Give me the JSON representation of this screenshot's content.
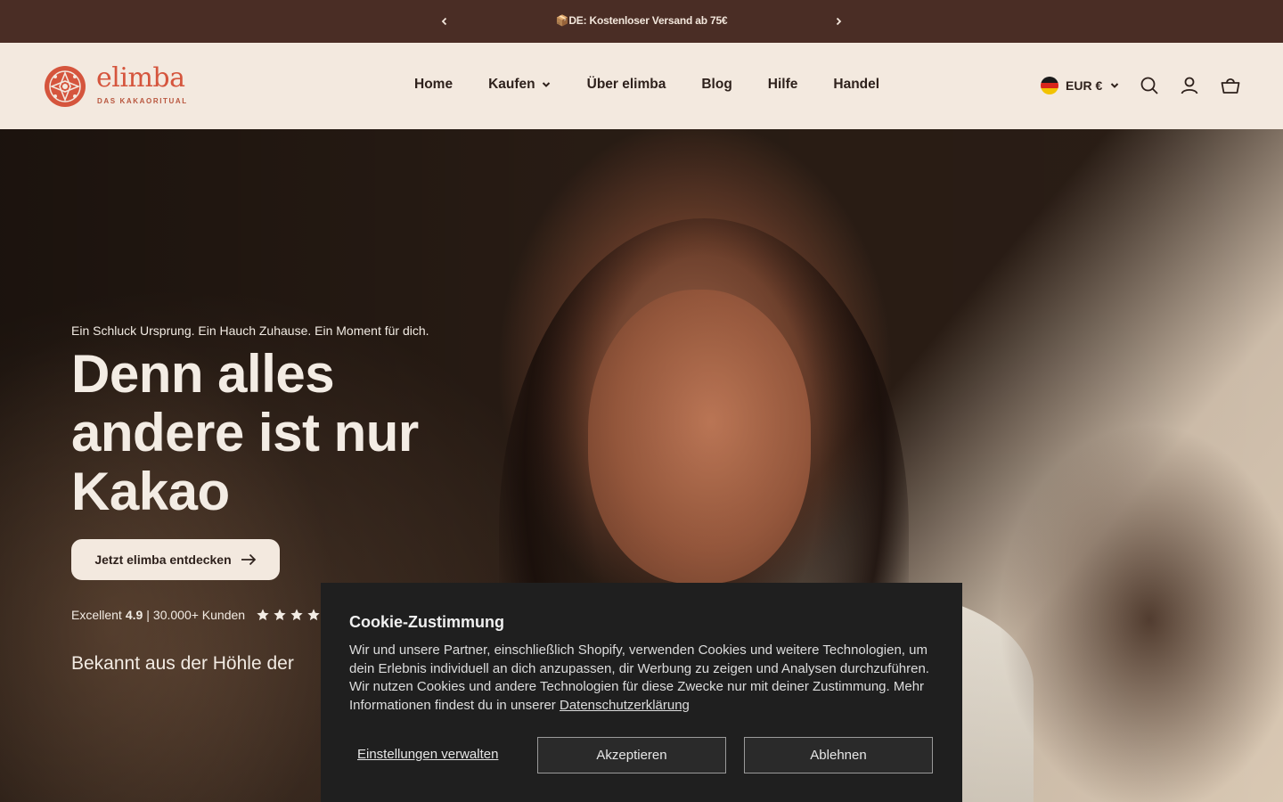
{
  "announcement": {
    "message": "📦DE: Kostenloser Versand ab 75€"
  },
  "header": {
    "logo_text": "elimba",
    "logo_tagline": "DAS KAKAORITUAL",
    "nav": [
      {
        "label": "Home"
      },
      {
        "label": "Kaufen",
        "has_dropdown": true
      },
      {
        "label": "Über elimba"
      },
      {
        "label": "Blog"
      },
      {
        "label": "Hilfe"
      },
      {
        "label": "Handel"
      }
    ],
    "currency": "EUR €",
    "icons": [
      "search-icon",
      "account-icon",
      "cart-icon"
    ]
  },
  "hero": {
    "tagline": "Ein Schluck Ursprung. Ein Hauch Zuhause. Ein Moment für dich.",
    "headline": "Denn alles andere ist nur Kakao",
    "cta_label": "Jetzt elimba entdecken",
    "rating_prefix": "Excellent",
    "rating_score": "4.9",
    "rating_separator": "|",
    "rating_customers": "30.000+ Kunden",
    "stars": 5,
    "known_from": "Bekannt aus der Höhle der"
  },
  "cookie": {
    "title": "Cookie-Zustimmung",
    "body": "Wir und unsere Partner, einschließlich Shopify, verwenden Cookies und weitere Technologien, um dein Erlebnis individuell an dich anzupassen, dir Werbung zu zeigen und Analysen durchzuführen. Wir nutzen Cookies und andere Technologien für diese Zwecke nur mit deiner Zustimmung. Mehr Informationen findest du in unserer",
    "privacy_link": "Datenschutzerklärung",
    "manage_label": "Einstellungen verwalten",
    "accept_label": "Akzeptieren",
    "decline_label": "Ablehnen"
  },
  "colors": {
    "announcement_bg": "#4a2d25",
    "header_bg": "#f3e9df",
    "brand": "#d5553d",
    "cookie_bg": "#1f1f1f"
  }
}
